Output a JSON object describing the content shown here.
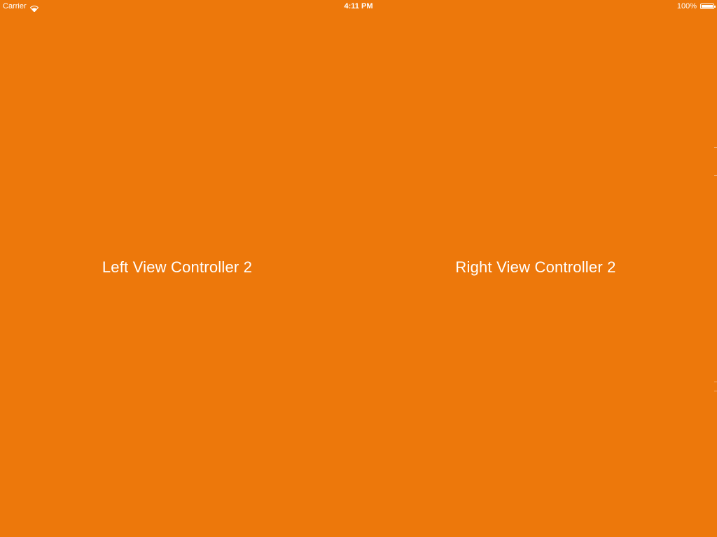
{
  "status_bar": {
    "carrier": "Carrier",
    "time": "4:11 PM",
    "battery_percent": "100%",
    "wifi_icon": "wifi-icon",
    "battery_icon": "battery-icon",
    "battery_level": 1.0
  },
  "left_pane": {
    "label": "Left View Controller 2"
  },
  "right_pane": {
    "label": "Right View Controller 2"
  },
  "colors": {
    "background": "#ED780B",
    "text": "#FFFFFF"
  }
}
